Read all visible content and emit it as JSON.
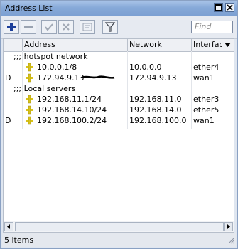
{
  "window": {
    "title": "Address List"
  },
  "toolbar": {
    "buttons": [
      {
        "icon": "add-icon"
      },
      {
        "icon": "remove-icon"
      },
      {
        "icon": "enable-check-icon"
      },
      {
        "icon": "disable-x-icon"
      },
      {
        "icon": "comment-icon"
      },
      {
        "icon": "filter-icon"
      }
    ],
    "find_placeholder": "Find"
  },
  "table": {
    "columns": [
      "",
      "Address",
      "Network",
      "Interface"
    ],
    "rows": [
      {
        "type": "comment",
        "text": ";;; hotspot network"
      },
      {
        "type": "entry",
        "flag": "",
        "address": "10.0.0.1/8",
        "network": "10.0.0.0",
        "interface": "ether4"
      },
      {
        "type": "entry",
        "flag": "D",
        "address": "172.94.9.13",
        "network": "172.94.9.13",
        "interface": "wan1"
      },
      {
        "type": "comment",
        "text": ";;; Local servers"
      },
      {
        "type": "entry",
        "flag": "",
        "address": "192.168.11.1/24",
        "network": "192.168.11.0",
        "interface": "ether3"
      },
      {
        "type": "entry",
        "flag": "",
        "address": "192.168.14.10/24",
        "network": "192.168.14.0",
        "interface": "ether5"
      },
      {
        "type": "entry",
        "flag": "D",
        "address": "192.168.100.2/24",
        "network": "192.168.100.0",
        "interface": "wan1"
      }
    ]
  },
  "status": {
    "text": "5 items"
  },
  "colors": {
    "entry_icon": "#d8c21a",
    "add_icon": "#1c3f9a",
    "title_bar": "#86a9d8"
  }
}
